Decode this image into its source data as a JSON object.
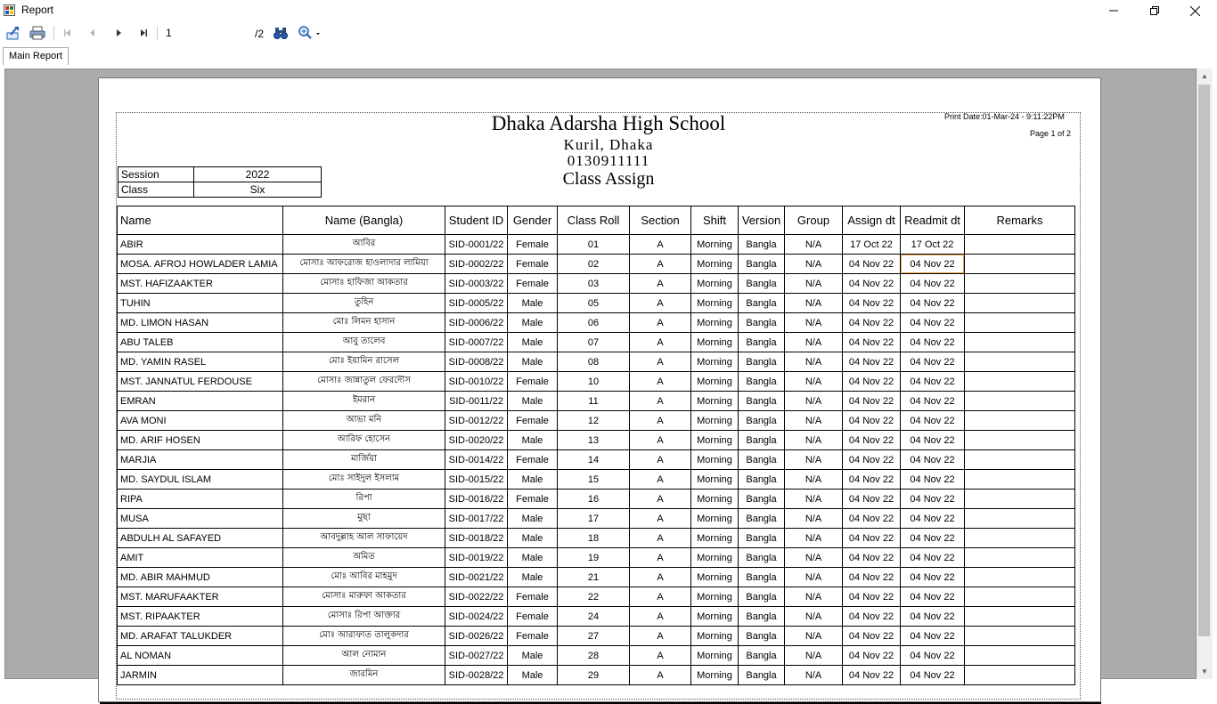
{
  "window": {
    "title": "Report"
  },
  "toolbar": {
    "page_value": "1",
    "page_total": "/2"
  },
  "tabs": [
    {
      "label": "Main Report"
    }
  ],
  "report": {
    "school_name": "Dhaka Adarsha High School",
    "address": "Kuril, Dhaka",
    "phone": "0130911111",
    "report_title": "Class Assign",
    "print_date": "Print Date:01-Mar-24 - 9:11:22PM",
    "page_info": "Page 1 of 2",
    "session_label": "Session",
    "session_value": "2022",
    "class_label": "Class",
    "class_value": "Six"
  },
  "columns": [
    "Name",
    "Name (Bangla)",
    "Student ID",
    "Gender",
    "Class Roll",
    "Section",
    "Shift",
    "Version",
    "Group",
    "Assign dt",
    "Readmit dt",
    "Remarks"
  ],
  "rows": [
    [
      "ABIR",
      "আবির",
      "SID-0001/22",
      "Female",
      "01",
      "A",
      "Morning",
      "Bangla",
      "N/A",
      "17 Oct 22",
      "17 Oct 22",
      ""
    ],
    [
      "MOSA. AFROJ HOWLADER LAMIA",
      "মোসাঃ আফরোজ হাওলাদার লামিয়া",
      "SID-0002/22",
      "Female",
      "02",
      "A",
      "Morning",
      "Bangla",
      "N/A",
      "04 Nov 22",
      "04 Nov 22",
      ""
    ],
    [
      "MST. HAFIZAAKTER",
      "মোসাঃ হাফিজা আকতার",
      "SID-0003/22",
      "Female",
      "03",
      "A",
      "Morning",
      "Bangla",
      "N/A",
      "04 Nov 22",
      "04 Nov 22",
      ""
    ],
    [
      "TUHIN",
      "তুহিন",
      "SID-0005/22",
      "Male",
      "05",
      "A",
      "Morning",
      "Bangla",
      "N/A",
      "04 Nov 22",
      "04 Nov 22",
      ""
    ],
    [
      "MD. LIMON HASAN",
      "মোঃ লিমন হাসান",
      "SID-0006/22",
      "Male",
      "06",
      "A",
      "Morning",
      "Bangla",
      "N/A",
      "04 Nov 22",
      "04 Nov 22",
      ""
    ],
    [
      "ABU TALEB",
      "আবু তালেব",
      "SID-0007/22",
      "Male",
      "07",
      "A",
      "Morning",
      "Bangla",
      "N/A",
      "04 Nov 22",
      "04 Nov 22",
      ""
    ],
    [
      "MD. YAMIN RASEL",
      "মোঃ ইয়ামিন রাসেল",
      "SID-0008/22",
      "Male",
      "08",
      "A",
      "Morning",
      "Bangla",
      "N/A",
      "04 Nov 22",
      "04 Nov 22",
      ""
    ],
    [
      "MST. JANNATUL FERDOUSE",
      "মোসাঃ জান্নাতুল ফেরদৌস",
      "SID-0010/22",
      "Female",
      "10",
      "A",
      "Morning",
      "Bangla",
      "N/A",
      "04 Nov 22",
      "04 Nov 22",
      ""
    ],
    [
      "EMRAN",
      "ইমরান",
      "SID-0011/22",
      "Male",
      "11",
      "A",
      "Morning",
      "Bangla",
      "N/A",
      "04 Nov 22",
      "04 Nov 22",
      ""
    ],
    [
      "AVA MONI",
      "আভা মনি",
      "SID-0012/22",
      "Female",
      "12",
      "A",
      "Morning",
      "Bangla",
      "N/A",
      "04 Nov 22",
      "04 Nov 22",
      ""
    ],
    [
      "MD. ARIF HOSEN",
      "আরিফ হোসেন",
      "SID-0020/22",
      "Male",
      "13",
      "A",
      "Morning",
      "Bangla",
      "N/A",
      "04 Nov 22",
      "04 Nov 22",
      ""
    ],
    [
      "MARJIA",
      "মার্জিয়া",
      "SID-0014/22",
      "Female",
      "14",
      "A",
      "Morning",
      "Bangla",
      "N/A",
      "04 Nov 22",
      "04 Nov 22",
      ""
    ],
    [
      "MD. SAYDUL ISLAM",
      "মোঃ সাইদুল ইসলাম",
      "SID-0015/22",
      "Male",
      "15",
      "A",
      "Morning",
      "Bangla",
      "N/A",
      "04 Nov 22",
      "04 Nov 22",
      ""
    ],
    [
      "RIPA",
      "রিপা",
      "SID-0016/22",
      "Female",
      "16",
      "A",
      "Morning",
      "Bangla",
      "N/A",
      "04 Nov 22",
      "04 Nov 22",
      ""
    ],
    [
      "MUSA",
      "মুছা",
      "SID-0017/22",
      "Male",
      "17",
      "A",
      "Morning",
      "Bangla",
      "N/A",
      "04 Nov 22",
      "04 Nov 22",
      ""
    ],
    [
      "ABDULH AL SAFAYED",
      "আবদুল্লাহ আল সাফায়েদ",
      "SID-0018/22",
      "Male",
      "18",
      "A",
      "Morning",
      "Bangla",
      "N/A",
      "04 Nov 22",
      "04 Nov 22",
      ""
    ],
    [
      "AMIT",
      "অমিত",
      "SID-0019/22",
      "Male",
      "19",
      "A",
      "Morning",
      "Bangla",
      "N/A",
      "04 Nov 22",
      "04 Nov 22",
      ""
    ],
    [
      "MD. ABIR MAHMUD",
      "মোঃ আবির মাহমুদ",
      "SID-0021/22",
      "Male",
      "21",
      "A",
      "Morning",
      "Bangla",
      "N/A",
      "04 Nov 22",
      "04 Nov 22",
      ""
    ],
    [
      "MST. MARUFAAKTER",
      "মোসাঃ মারুফা আকতার",
      "SID-0022/22",
      "Female",
      "22",
      "A",
      "Morning",
      "Bangla",
      "N/A",
      "04 Nov 22",
      "04 Nov 22",
      ""
    ],
    [
      "MST. RIPAAKTER",
      "মোসাঃ রিপা আক্তার",
      "SID-0024/22",
      "Female",
      "24",
      "A",
      "Morning",
      "Bangla",
      "N/A",
      "04 Nov 22",
      "04 Nov 22",
      ""
    ],
    [
      "MD. ARAFAT TALUKDER",
      "মোঃ আরাফাত তালুকদার",
      "SID-0026/22",
      "Female",
      "27",
      "A",
      "Morning",
      "Bangla",
      "N/A",
      "04 Nov 22",
      "04 Nov 22",
      ""
    ],
    [
      "AL NOMAN",
      "আল নোমান",
      "SID-0027/22",
      "Male",
      "28",
      "A",
      "Morning",
      "Bangla",
      "N/A",
      "04 Nov 22",
      "04 Nov 22",
      ""
    ],
    [
      "JARMIN",
      "জারমিন",
      "SID-0028/22",
      "Male",
      "29",
      "A",
      "Morning",
      "Bangla",
      "N/A",
      "04 Nov 22",
      "04 Nov 22",
      ""
    ]
  ],
  "icons": {
    "app": "report-app-icon",
    "export": "export-icon",
    "print": "print-icon",
    "first": "first-page-icon",
    "prev": "previous-page-icon",
    "next": "next-page-icon",
    "last": "last-page-icon",
    "find": "binoculars-icon",
    "zoom": "zoom-icon"
  },
  "colors": {
    "viewport_bg": "#ababab",
    "accent": "#1f5fb5",
    "highlight": "#e7a24d"
  }
}
